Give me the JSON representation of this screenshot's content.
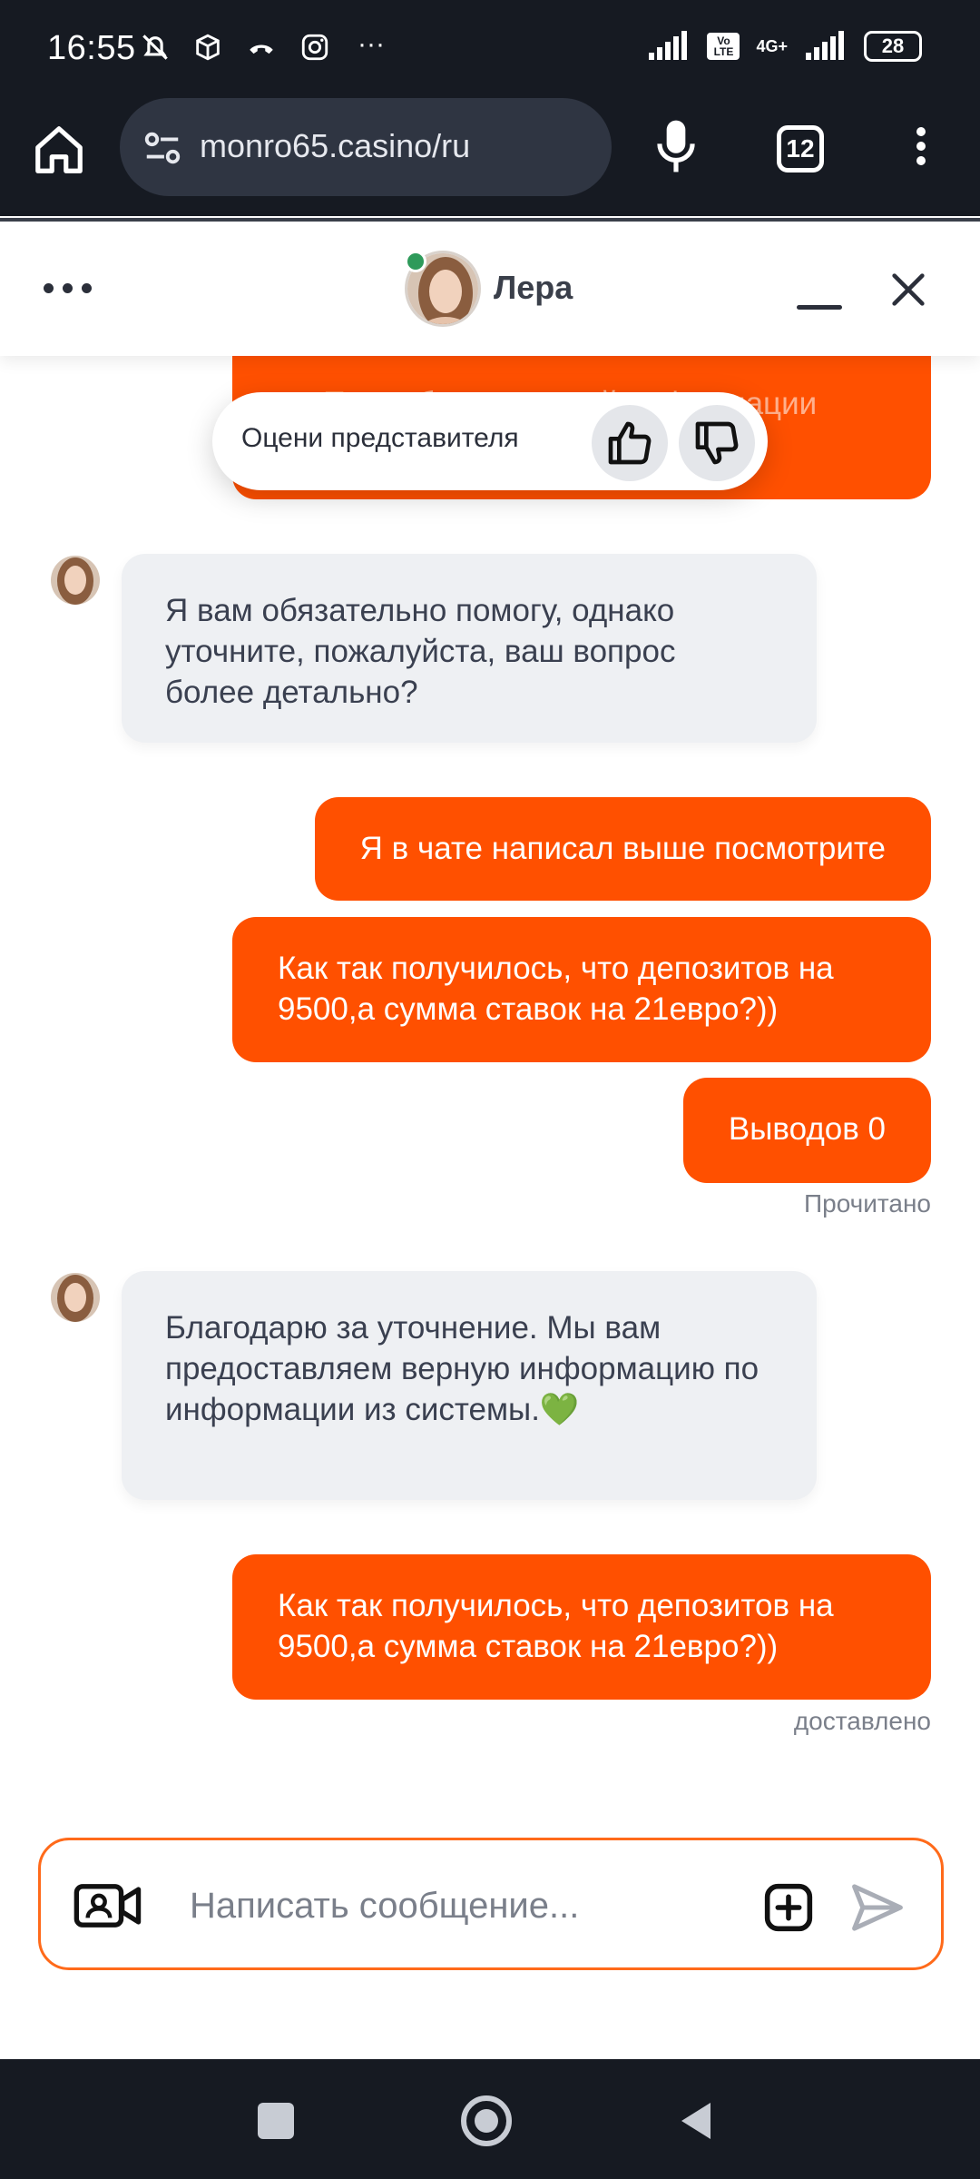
{
  "status_bar": {
    "time": "16:55",
    "battery": "28",
    "network": "4G+",
    "volte": "Vo LTE",
    "more": "···"
  },
  "browser": {
    "url": "monro65.casino/ru",
    "tab_count": "12"
  },
  "chat_header": {
    "agent_name": "Лера"
  },
  "rating": {
    "label": "Оцени представителя"
  },
  "messages": [
    {
      "from": "me",
      "text": "Подробнее о вашей информации уточните вопрос."
    },
    {
      "from": "agent",
      "text": "Я вам обязательно помогу, однако уточните, пожалуйста, ваш вопрос более детально?"
    },
    {
      "from": "me",
      "text": "Я в чате написал выше посмотрите"
    },
    {
      "from": "me",
      "text": "Как так получилось, что депозитов на 9500,а сумма ставок на 21евро?))"
    },
    {
      "from": "me",
      "text": "Выводов 0"
    },
    {
      "from": "agent",
      "text": "Благодарю за уточнение. Мы вам предоставляем верную информацию по информации из системы.💚"
    },
    {
      "from": "me",
      "text": "Как так получилось, что депозитов на 9500,а сумма ставок на 21евро?))"
    }
  ],
  "statuses": {
    "read": "Прочитано",
    "delivered": "доставлено"
  },
  "composer": {
    "placeholder": "Написать сообщение..."
  },
  "colors": {
    "accent": "#ff5000",
    "dark_bar": "#161a22",
    "agent_bubble": "#eef0f3"
  }
}
